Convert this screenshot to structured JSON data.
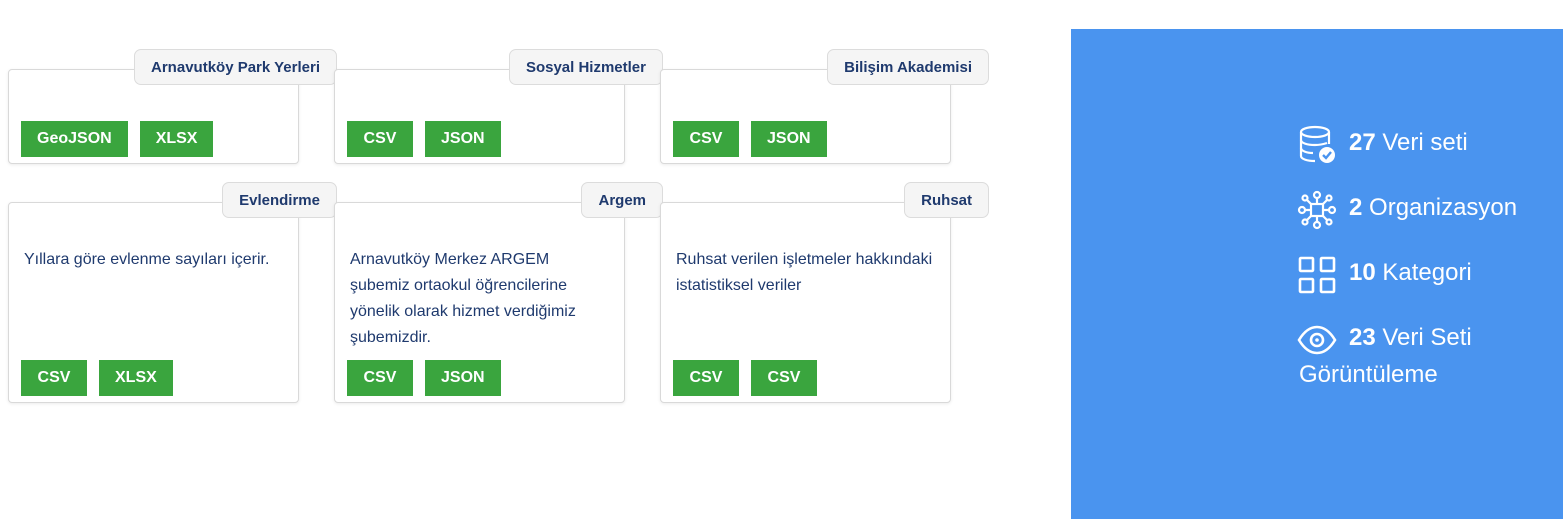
{
  "cards": [
    {
      "title": "Arnavutköy Park Yerleri",
      "description": "",
      "formats": [
        "GeoJSON",
        "XLSX"
      ]
    },
    {
      "title": "Sosyal Hizmetler",
      "description": "",
      "formats": [
        "CSV",
        "JSON"
      ]
    },
    {
      "title": "Bilişim Akademisi",
      "description": "",
      "formats": [
        "CSV",
        "JSON"
      ]
    },
    {
      "title": "Evlendirme",
      "description": "Yıllara göre evlenme sayıları içerir.",
      "formats": [
        "CSV",
        "XLSX"
      ]
    },
    {
      "title": "Argem",
      "description": "Arnavutköy Merkez ARGEM şubemiz ortaokul öğrencilerine yönelik olarak hizmet verdiğimiz şubemizdir.",
      "formats": [
        "CSV",
        "JSON"
      ]
    },
    {
      "title": "Ruhsat",
      "description": "Ruhsat verilen işletmeler hakkındaki istatistiksel veriler",
      "formats": [
        "CSV",
        "CSV"
      ]
    }
  ],
  "stats": {
    "datasets": {
      "count": "27",
      "label": "Veri seti",
      "icon": "database-check-icon"
    },
    "organizations": {
      "count": "2",
      "label": "Organizasyon",
      "icon": "network-icon"
    },
    "categories": {
      "count": "10",
      "label": "Kategori",
      "icon": "grid-icon"
    },
    "views": {
      "count": "23",
      "label": "Veri Seti",
      "label2": "Görüntüleme",
      "icon": "eye-icon"
    }
  },
  "colors": {
    "accent_panel": "#4a94ef",
    "format_badge": "#3aa53e",
    "title_text": "#1f3a6e"
  }
}
